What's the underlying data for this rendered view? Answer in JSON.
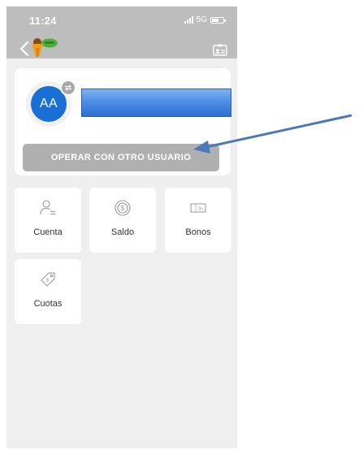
{
  "status_bar": {
    "time": "11:24",
    "network": "5G",
    "icons": [
      "signal-icon",
      "battery-icon"
    ]
  },
  "header": {
    "icons": [
      "back-chevron-icon",
      "app-logo",
      "id-card-icon"
    ]
  },
  "user_card": {
    "avatar_initials": "AA",
    "operate_button_label": "OPERAR CON OTRO USUARIO",
    "icons": [
      "swap-icon"
    ]
  },
  "menu": {
    "items": [
      {
        "label": "Cuenta",
        "icon": "user-list-icon"
      },
      {
        "label": "Saldo",
        "icon": "coin-icon"
      },
      {
        "label": "Bonos",
        "icon": "voucher-icon"
      },
      {
        "label": "Cuotas",
        "icon": "tag-icon"
      }
    ]
  },
  "colors": {
    "header_bg": "#bdbdbd",
    "screen_bg": "#efefef",
    "avatar_blue": "#1a6fd6",
    "button_gray": "#b0b0b0",
    "annotation_arrow": "#4a78b8"
  }
}
